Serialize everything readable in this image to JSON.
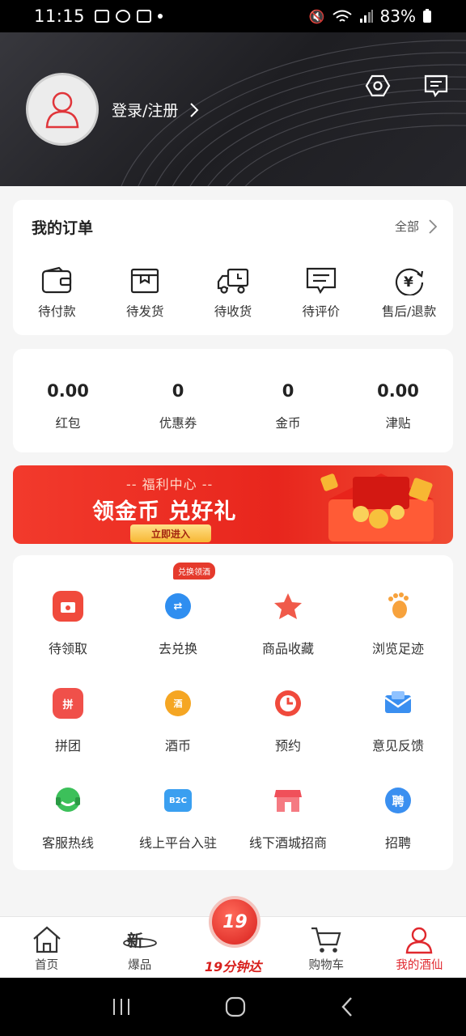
{
  "status_bar": {
    "time": "11:15",
    "battery": "83%"
  },
  "header": {
    "login_label": "登录/注册"
  },
  "orders": {
    "title": "我的订单",
    "all_label": "全部",
    "items": [
      {
        "label": "待付款",
        "icon": "wallet-icon"
      },
      {
        "label": "待发货",
        "icon": "box-icon"
      },
      {
        "label": "待收货",
        "icon": "truck-icon"
      },
      {
        "label": "待评价",
        "icon": "comment-icon"
      },
      {
        "label": "售后/退款",
        "icon": "refund-icon"
      }
    ]
  },
  "wallet": {
    "items": [
      {
        "value": "0.00",
        "label": "红包"
      },
      {
        "value": "0",
        "label": "优惠券"
      },
      {
        "value": "0",
        "label": "金币"
      },
      {
        "value": "0.00",
        "label": "津贴"
      }
    ]
  },
  "banner": {
    "subtitle": "-- 福利中心 --",
    "title": "领金币 兑好礼",
    "button": "立即进入"
  },
  "services": {
    "tag": "兑换领酒",
    "rows": [
      [
        {
          "label": "待领取",
          "icon": "gift-box-icon",
          "color": "#f04a3c"
        },
        {
          "label": "去兑换",
          "icon": "exchange-icon",
          "color": "#2f8ef0"
        },
        {
          "label": "商品收藏",
          "icon": "star-icon",
          "color": "#f05a4a"
        },
        {
          "label": "浏览足迹",
          "icon": "footprint-icon",
          "color": "#f7a23c"
        }
      ],
      [
        {
          "label": "拼团",
          "icon": "group-buy-icon",
          "color": "#f0504a",
          "glyph": "拼"
        },
        {
          "label": "酒币",
          "icon": "coin-icon",
          "color": "#f5a623",
          "glyph": "酒"
        },
        {
          "label": "预约",
          "icon": "clock-icon",
          "color": "#f04a3c"
        },
        {
          "label": "意见反馈",
          "icon": "mail-icon",
          "color": "#3a8ff0"
        }
      ],
      [
        {
          "label": "客服热线",
          "icon": "headset-icon",
          "color": "#3cc05a"
        },
        {
          "label": "线上平台入驻",
          "icon": "b2c-icon",
          "color": "#3a9ff0",
          "glyph": "B2C"
        },
        {
          "label": "线下酒城招商",
          "icon": "store-icon",
          "color": "#f0505a"
        },
        {
          "label": "招聘",
          "icon": "recruit-icon",
          "color": "#3a8ff0",
          "glyph": "聘"
        }
      ]
    ]
  },
  "tabbar": {
    "items": [
      {
        "label": "首页",
        "icon": "home-icon"
      },
      {
        "label": "爆品",
        "icon": "hot-product-icon"
      },
      {
        "label": "19分钟达",
        "icon": "delivery-19-icon",
        "badge": "19"
      },
      {
        "label": "购物车",
        "icon": "cart-icon"
      },
      {
        "label": "我的酒仙",
        "icon": "profile-icon"
      }
    ]
  }
}
